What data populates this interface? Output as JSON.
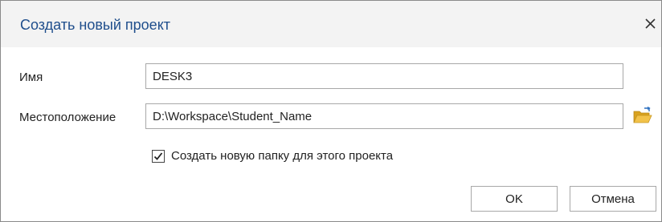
{
  "dialog": {
    "title": "Создать новый проект",
    "close_icon": "close-icon"
  },
  "form": {
    "name_label": "Имя",
    "name_value": "DESK3",
    "location_label": "Местоположение",
    "location_value": "D:\\Workspace\\Student_Name",
    "browse_icon": "open-folder-icon",
    "create_folder_checked": true,
    "create_folder_label": "Создать новую папку для этого проекта"
  },
  "buttons": {
    "ok_label": "OK",
    "cancel_label": "Отмена"
  },
  "colors": {
    "title": "#1f4e8c",
    "titlebar_bg": "#f3f3f3",
    "folder_icon": "#e8b330"
  }
}
